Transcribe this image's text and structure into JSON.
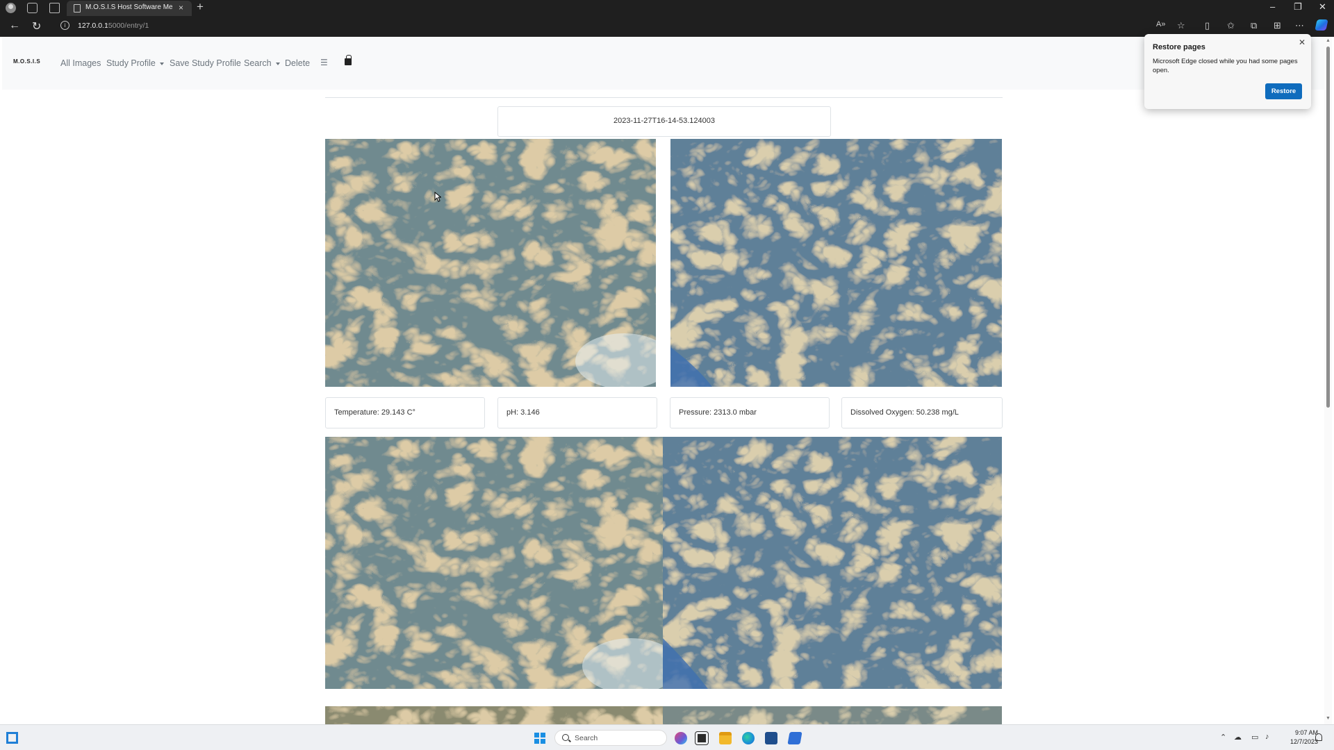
{
  "browser": {
    "tab_title": "M.O.S.I.S Host Software Media E",
    "tab_close": "×",
    "new_tab": "+",
    "window_min": "–",
    "window_restore": "❐",
    "window_close": "✕",
    "url_host": "127.0.0.1",
    "url_path": ":5000/entry/1",
    "back_icon": "←",
    "refresh_icon": "↻",
    "toolbar_icons": [
      "read-aloud-icon",
      "favorite-star-icon",
      "split-screen-icon",
      "favorites-icon",
      "collections-icon",
      "extensions-icon",
      "more-menu-icon",
      "copilot-icon"
    ]
  },
  "navbar": {
    "brand": "M.O.S.I.S",
    "links": [
      "All Images",
      "Study Profile",
      "Save Study Profile",
      "Search",
      "Delete"
    ],
    "dropdown_links": [
      "Study Profile",
      "Search"
    ]
  },
  "entry": {
    "timestamp": "2023-11-27T16-14-53.124003",
    "readings": {
      "temperature": "Temperature: 29.143 C°",
      "ph": "pH: 3.146",
      "pressure": "Pressure: 2313.0 mbar",
      "dissolved_oxygen": "Dissolved Oxygen: 50.238 mg/L"
    }
  },
  "popup": {
    "title": "Restore pages",
    "message": "Microsoft Edge closed while you had some pages open.",
    "button": "Restore",
    "close": "✕"
  },
  "taskbar": {
    "search_placeholder": "Search",
    "time": "9:07 AM",
    "date": "12/7/2023",
    "tray_icons": [
      "chevron-up-icon",
      "onedrive-icon",
      "network-icon",
      "volume-icon",
      "notification-bell-icon"
    ]
  },
  "colors": {
    "navbar_bg": "#f8f9fa",
    "link": "#6c757d",
    "accent": "#0f6cbd",
    "coral_tan": "#b59a62",
    "coral_blue": "#6b8ba0"
  }
}
